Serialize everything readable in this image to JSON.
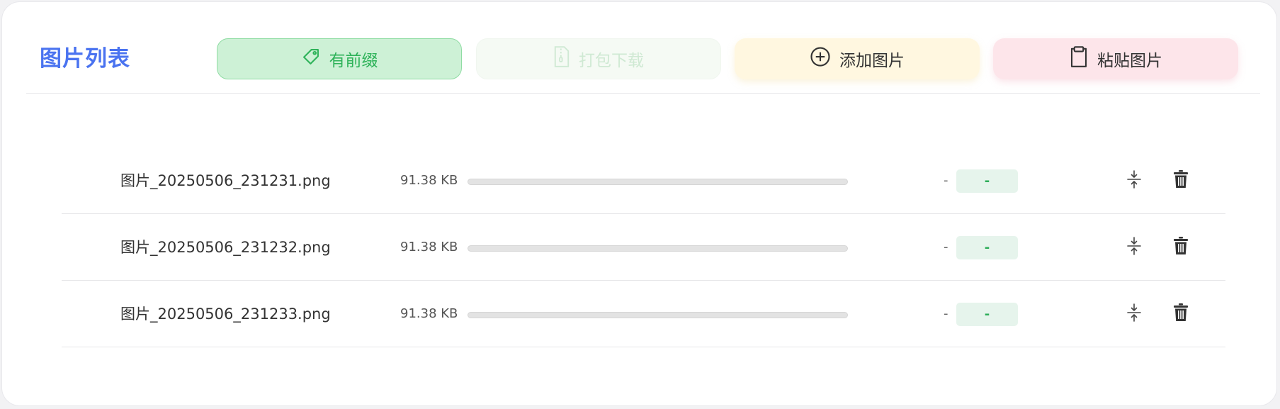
{
  "header": {
    "title": "图片列表",
    "buttons": {
      "prefix": {
        "label": "有前缀",
        "icon": "tag-icon",
        "color": "#2fb35a"
      },
      "download": {
        "label": "打包下载",
        "icon": "zip-file-icon",
        "disabled": true
      },
      "add": {
        "label": "添加图片",
        "icon": "plus-circle-icon"
      },
      "paste": {
        "label": "粘贴图片",
        "icon": "clipboard-icon"
      }
    }
  },
  "files": [
    {
      "name": "图片_20250506_231231.png",
      "size": "91.38 KB",
      "progress": 0,
      "compressed_size": "-",
      "ratio": "-"
    },
    {
      "name": "图片_20250506_231232.png",
      "size": "91.38 KB",
      "progress": 0,
      "compressed_size": "-",
      "ratio": "-"
    },
    {
      "name": "图片_20250506_231233.png",
      "size": "91.38 KB",
      "progress": 0,
      "compressed_size": "-",
      "ratio": "-"
    }
  ],
  "row_actions": {
    "compress_icon": "compress-arrows-icon",
    "delete_icon": "trash-icon"
  },
  "colors": {
    "title": "#4a73f0",
    "prefix_bg": "#cdf1d6",
    "download_bg": "#f5faf4",
    "add_bg": "#fff7e0",
    "paste_bg": "#fde5ea",
    "badge_bg": "#e6f4ec",
    "badge_text": "#2fae5a"
  }
}
